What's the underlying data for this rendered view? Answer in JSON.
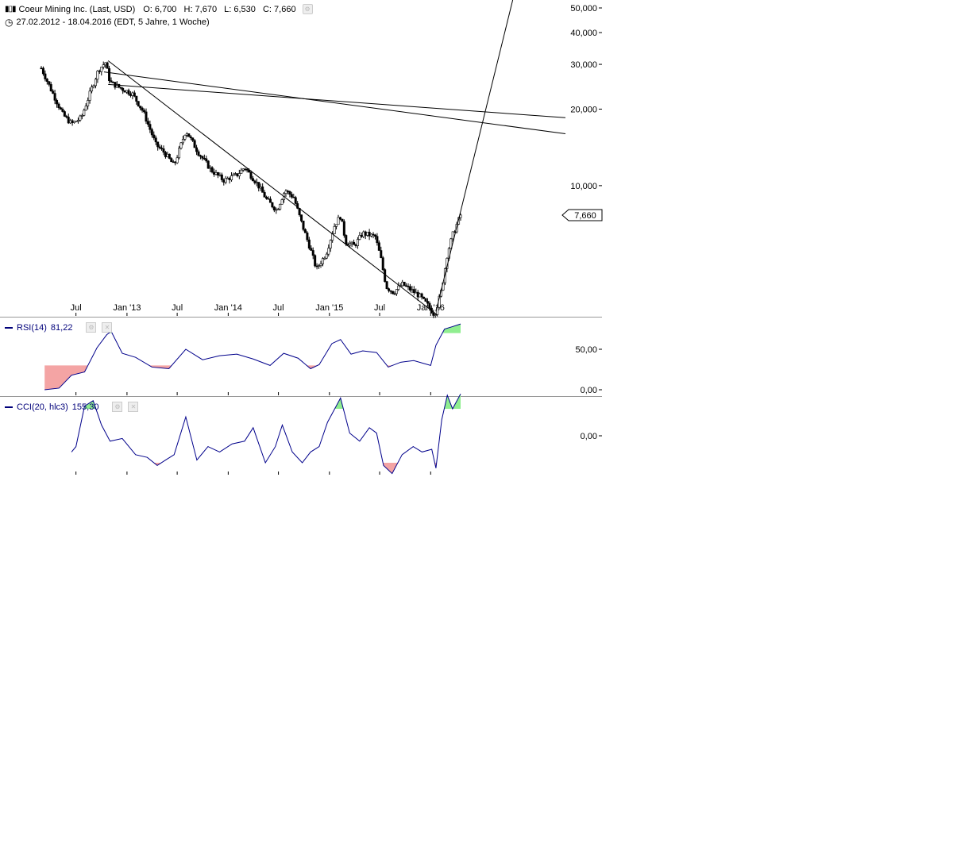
{
  "header": {
    "title": "Coeur Mining Inc. (Last, USD)",
    "open": "O: 6,700",
    "high": "H: 7,670",
    "low": "L: 6,530",
    "close": "C: 7,660",
    "range": "27.02.2012 - 18.04.2016 (EDT, 5 Jahre, 1 Woche)"
  },
  "icons": {
    "chart": "candlestick-icon",
    "clock": "clock-icon",
    "gear": "gear-icon",
    "close": "close-icon"
  },
  "colors": {
    "line": "#000000",
    "rsi": "#00008b",
    "overbought": "#90ee90",
    "oversold": "#f4a4a4",
    "grid": "#888888"
  },
  "chart_data": [
    {
      "type": "candlestick",
      "title": "Coeur Mining Inc. (Last, USD)",
      "scale": "log",
      "ylim": [
        3.6,
        60
      ],
      "yticks": [
        10,
        20,
        30,
        40,
        50
      ],
      "ytick_labels": [
        "10,000",
        "20,000",
        "30,000",
        "40,000",
        "50,000"
      ],
      "x_range": [
        "2012-02-27",
        "2016-04-18"
      ],
      "xticks": [
        "2012-07-01",
        "2013-01-01",
        "2013-07-01",
        "2014-01-01",
        "2014-07-01",
        "2015-01-01",
        "2015-07-01",
        "2016-01-01"
      ],
      "xtick_labels": [
        "Jul",
        "Jan '13",
        "Jul",
        "Jan '14",
        "Jul",
        "Jan '15",
        "Jul",
        "Jan '16"
      ],
      "last_price_label": "7,660",
      "last_price": 7.66,
      "close_path": [
        [
          "2012-02-27",
          29.0
        ],
        [
          "2012-04-01",
          24.0
        ],
        [
          "2012-05-15",
          19.0
        ],
        [
          "2012-06-15",
          17.5
        ],
        [
          "2012-07-20",
          18.5
        ],
        [
          "2012-08-20",
          23.0
        ],
        [
          "2012-09-20",
          28.5
        ],
        [
          "2012-10-15",
          30.5
        ],
        [
          "2012-11-01",
          25.5
        ],
        [
          "2012-12-15",
          24.0
        ],
        [
          "2013-01-20",
          23.0
        ],
        [
          "2013-03-01",
          19.5
        ],
        [
          "2013-04-15",
          14.5
        ],
        [
          "2013-05-15",
          13.5
        ],
        [
          "2013-06-20",
          12.0
        ],
        [
          "2013-08-01",
          16.5
        ],
        [
          "2013-09-15",
          13.5
        ],
        [
          "2013-11-01",
          11.5
        ],
        [
          "2013-12-15",
          10.5
        ],
        [
          "2014-02-01",
          11.0
        ],
        [
          "2014-03-01",
          11.8
        ],
        [
          "2014-04-15",
          10.2
        ],
        [
          "2014-05-20",
          8.8
        ],
        [
          "2014-06-25",
          8.0
        ],
        [
          "2014-07-25",
          9.6
        ],
        [
          "2014-08-25",
          9.0
        ],
        [
          "2014-09-25",
          7.0
        ],
        [
          "2014-10-25",
          5.6
        ],
        [
          "2014-11-15",
          4.7
        ],
        [
          "2014-12-20",
          5.4
        ],
        [
          "2015-01-20",
          7.0
        ],
        [
          "2015-02-10",
          7.6
        ],
        [
          "2015-03-01",
          6.0
        ],
        [
          "2015-04-01",
          5.8
        ],
        [
          "2015-05-01",
          6.5
        ],
        [
          "2015-06-15",
          6.3
        ],
        [
          "2015-07-05",
          5.2
        ],
        [
          "2015-07-25",
          4.0
        ],
        [
          "2015-08-20",
          3.8
        ],
        [
          "2015-09-20",
          4.1
        ],
        [
          "2015-10-20",
          3.9
        ],
        [
          "2015-11-20",
          3.7
        ],
        [
          "2015-12-20",
          3.4
        ],
        [
          "2016-01-15",
          3.1
        ],
        [
          "2016-02-10",
          3.9
        ],
        [
          "2016-03-01",
          5.4
        ],
        [
          "2016-03-20",
          6.4
        ],
        [
          "2016-04-18",
          7.66
        ]
      ],
      "trendlines": [
        {
          "from": [
            "2012-10-25",
            31.0
          ],
          "to": [
            "2016-01-25",
            3.1
          ]
        },
        {
          "from": [
            "2012-10-10",
            28.0
          ],
          "to": [
            "2017-05-01",
            16.0
          ]
        },
        {
          "from": [
            "2012-10-25",
            25.0
          ],
          "to": [
            "2017-05-01",
            18.5
          ]
        },
        {
          "from": [
            "2016-01-20",
            3.2
          ],
          "to": [
            "2016-12-01",
            80.0
          ]
        }
      ]
    },
    {
      "type": "line",
      "title": "RSI(14)",
      "current_value_label": "81,22",
      "ylim": [
        0,
        100
      ],
      "yticks": [
        0,
        50
      ],
      "ytick_labels": [
        "0,00",
        "50,00"
      ],
      "overbought": 70,
      "oversold": 30,
      "x": [
        "2012-03-10",
        "2012-05-01",
        "2012-06-15",
        "2012-08-01",
        "2012-09-15",
        "2012-10-20",
        "2012-11-05",
        "2012-12-15",
        "2013-02-01",
        "2013-04-01",
        "2013-06-01",
        "2013-08-01",
        "2013-10-01",
        "2013-12-01",
        "2014-02-01",
        "2014-04-01",
        "2014-06-01",
        "2014-07-20",
        "2014-09-10",
        "2014-10-25",
        "2014-11-25",
        "2015-01-10",
        "2015-02-10",
        "2015-03-20",
        "2015-05-01",
        "2015-06-20",
        "2015-08-01",
        "2015-09-15",
        "2015-11-01",
        "2016-01-01",
        "2016-01-20",
        "2016-02-20",
        "2016-03-20",
        "2016-04-18"
      ],
      "values": [
        0,
        2,
        18,
        22,
        52,
        68,
        72,
        45,
        40,
        28,
        26,
        50,
        37,
        42,
        44,
        38,
        30,
        45,
        39,
        26,
        31,
        57,
        62,
        44,
        48,
        46,
        28,
        34,
        36,
        30,
        55,
        75,
        78,
        81.22
      ]
    },
    {
      "type": "line",
      "title": "CCI(20, hlc3)",
      "current_value_label": "155,30",
      "ylim": [
        -150,
        175
      ],
      "yticks": [
        0
      ],
      "ytick_labels": [
        "0,00"
      ],
      "overbought": 100,
      "oversold": -100,
      "x": [
        "2012-06-15",
        "2012-07-01",
        "2012-08-01",
        "2012-09-01",
        "2012-10-01",
        "2012-11-01",
        "2012-12-15",
        "2013-02-01",
        "2013-03-15",
        "2013-04-20",
        "2013-05-20",
        "2013-06-20",
        "2013-08-01",
        "2013-09-10",
        "2013-10-20",
        "2013-12-01",
        "2014-01-15",
        "2014-03-01",
        "2014-04-01",
        "2014-05-15",
        "2014-06-20",
        "2014-07-15",
        "2014-08-20",
        "2014-09-25",
        "2014-10-25",
        "2014-11-25",
        "2014-12-25",
        "2015-02-10",
        "2015-03-15",
        "2015-04-20",
        "2015-05-25",
        "2015-06-20",
        "2015-07-15",
        "2015-08-15",
        "2015-09-20",
        "2015-10-30",
        "2015-12-01",
        "2016-01-05",
        "2016-01-20",
        "2016-02-10",
        "2016-03-01",
        "2016-03-20",
        "2016-04-18"
      ],
      "values": [
        -60,
        -40,
        110,
        130,
        40,
        -20,
        -10,
        -70,
        -80,
        -110,
        -90,
        -70,
        70,
        -90,
        -40,
        -60,
        -30,
        -20,
        30,
        -100,
        -40,
        40,
        -60,
        -100,
        -60,
        -40,
        50,
        140,
        10,
        -20,
        30,
        10,
        -110,
        -140,
        -70,
        -40,
        -60,
        -50,
        -120,
        60,
        150,
        100,
        155.3
      ]
    }
  ]
}
